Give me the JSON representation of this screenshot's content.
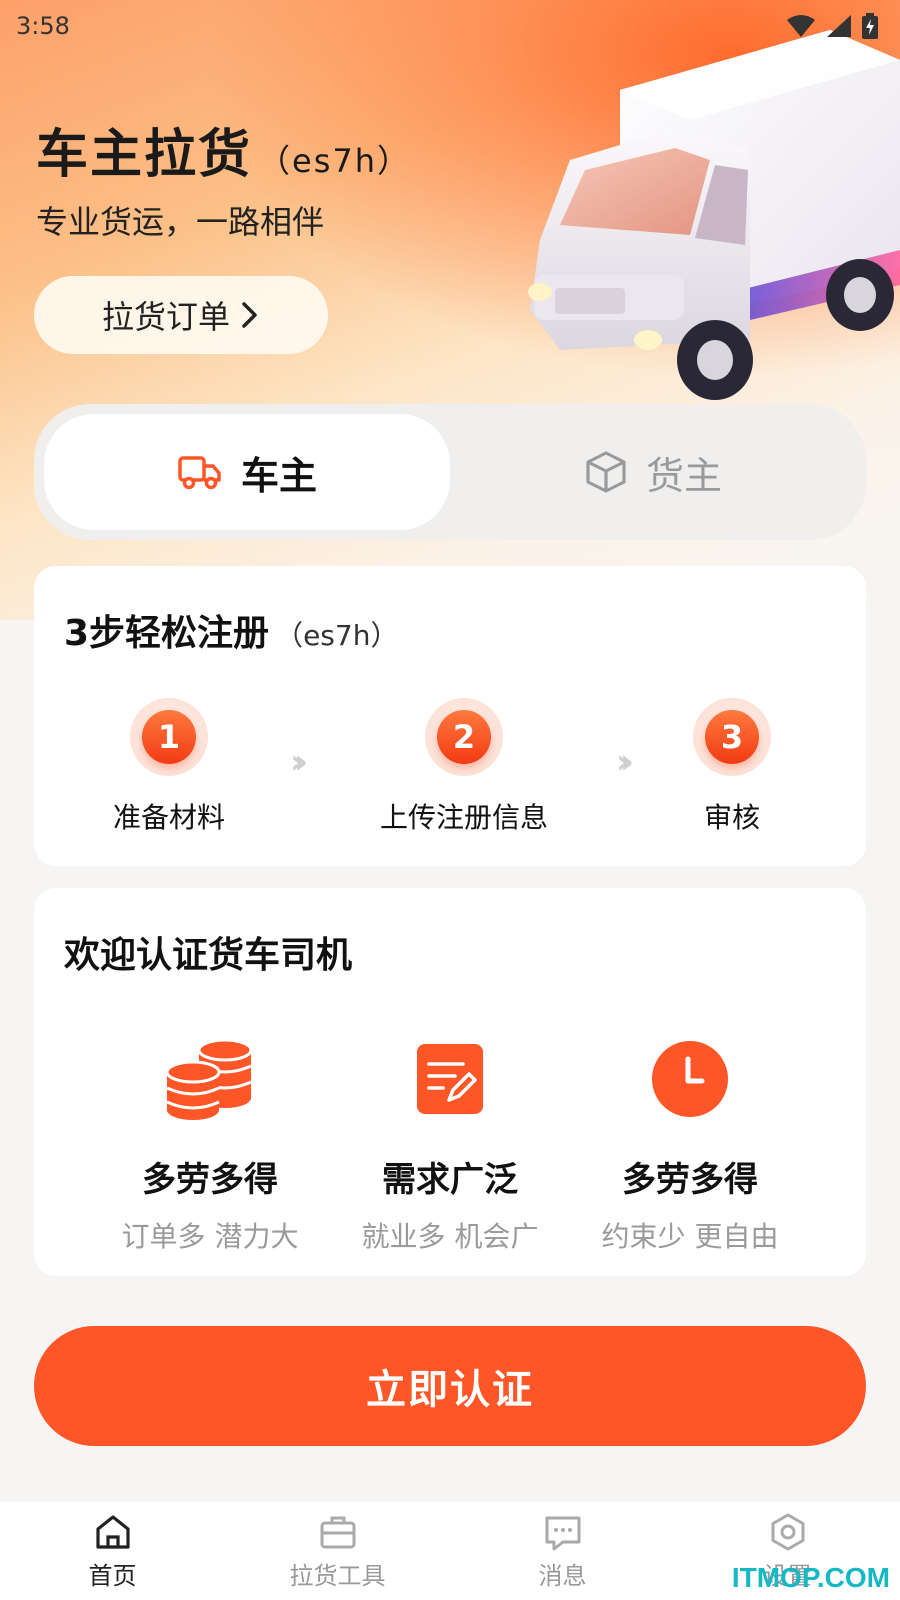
{
  "status_bar": {
    "time": "3:58"
  },
  "hero": {
    "title": "车主拉货",
    "title_suffix": "（es7h）",
    "subtitle": "专业货运，一路相伴",
    "order_button": "拉货订单"
  },
  "role_switch": {
    "tabs": [
      {
        "label": "车主",
        "icon": "truck-icon",
        "active": true
      },
      {
        "label": "货主",
        "icon": "box-icon",
        "active": false
      }
    ]
  },
  "register_card": {
    "title": "3步轻松注册",
    "title_suffix": "（es7h）",
    "steps": [
      {
        "number": "1",
        "label": "准备材料"
      },
      {
        "number": "2",
        "label": "上传注册信息"
      },
      {
        "number": "3",
        "label": "审核"
      }
    ]
  },
  "benefits_card": {
    "title": "欢迎认证货车司机",
    "items": [
      {
        "title": "多劳多得",
        "subtitle": "订单多 潜力大",
        "icon": "coins-icon"
      },
      {
        "title": "需求广泛",
        "subtitle": "就业多 机会广",
        "icon": "edit-note-icon"
      },
      {
        "title": "多劳多得",
        "subtitle": "约束少 更自由",
        "icon": "clock-icon"
      }
    ]
  },
  "cta": {
    "label": "立即认证"
  },
  "tabbar": {
    "items": [
      {
        "label": "首页",
        "icon": "home-icon",
        "active": true
      },
      {
        "label": "拉货工具",
        "icon": "briefcase-icon",
        "active": false
      },
      {
        "label": "消息",
        "icon": "message-icon",
        "active": false
      },
      {
        "label": "设置",
        "icon": "settings-icon",
        "active": false
      }
    ]
  },
  "watermark": "ITMOP.COM",
  "colors": {
    "accent": "#ff5628",
    "step_gradient_top": "#ff7a3d",
    "step_gradient_bottom": "#f23a14"
  }
}
